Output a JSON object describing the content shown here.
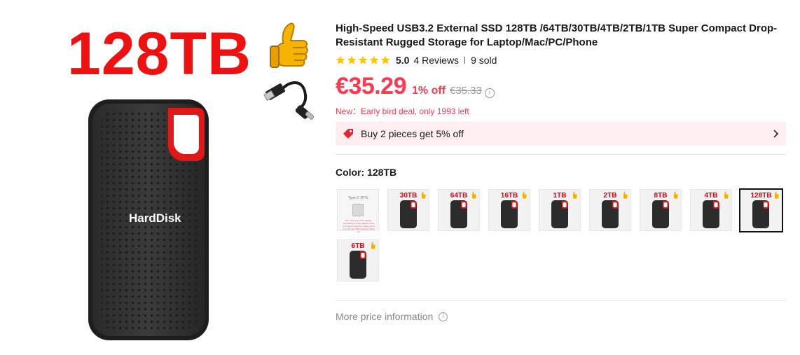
{
  "image": {
    "capacity_text": "128TB",
    "brand_text": "HardDisk",
    "icons": [
      "thumbs-up-icon",
      "usb-cable-icon"
    ]
  },
  "product": {
    "title": "High-Speed USB3.2 External SSD 128TB /64TB/30TB/4TB/2TB/1TB Super Compact Drop-Resistant Rugged Storage for Laptop/Mac/PC/Phone",
    "rating": "5.0",
    "stars_filled": 5,
    "reviews": "4 Reviews",
    "sold": "9 sold"
  },
  "price": {
    "current": "€35.29",
    "discount": "1% off",
    "original": "€35.33",
    "deal": "New：Early bird deal, only 1993 left"
  },
  "promo": {
    "text": "Buy 2 pieces get 5% off"
  },
  "color": {
    "label": "Color: 128TB",
    "options": [
      "",
      "30TB",
      "64TB",
      "16TB",
      "1TB",
      "2TB",
      "8TB",
      "4TB",
      "128TB",
      "6TB"
    ],
    "selected": "128TB",
    "otg_title": "Type-C OTG",
    "otg_note": "The order is an OTG adapter, purchasing a single adapter does not support shipping. Please send an order with SSD quantity. Thank you!"
  },
  "more_price": {
    "label": "More price information"
  },
  "colors": {
    "price_red": "#fd384f",
    "capacity_red": "#ee1111",
    "promo_bg": "#ffeef0",
    "star_gold": "#ffc400"
  }
}
